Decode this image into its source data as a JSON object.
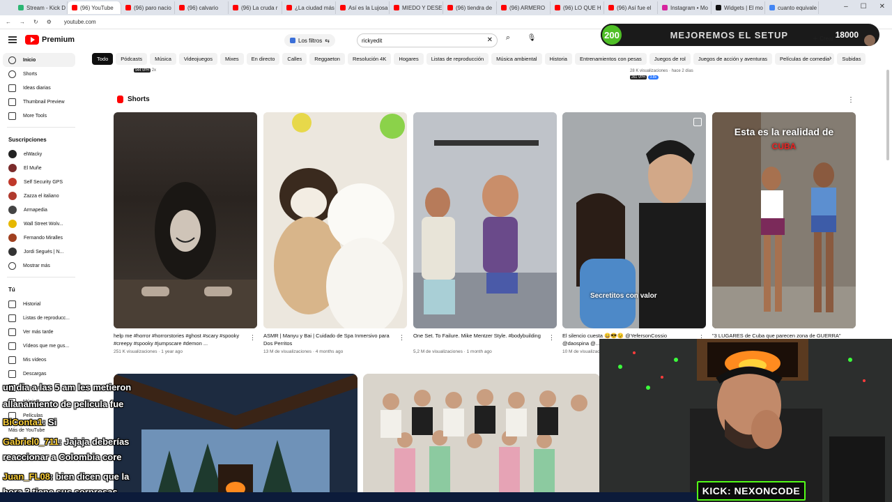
{
  "browser": {
    "tabs": [
      {
        "title": "Stream - Kick D",
        "color": "#2bb673"
      },
      {
        "title": "(96) YouTube",
        "color": "#ff0000",
        "active": true
      },
      {
        "title": "(96) paro nacio",
        "color": "#ff0000"
      },
      {
        "title": "(96) calvario",
        "color": "#ff0000"
      },
      {
        "title": "(96) La cruda r",
        "color": "#ff0000"
      },
      {
        "title": "¿La ciudad más",
        "color": "#ff0000"
      },
      {
        "title": "Así es la Lujosa",
        "color": "#ff0000"
      },
      {
        "title": "MIEDO Y DESE",
        "color": "#ff0000"
      },
      {
        "title": "(96) tiendra de",
        "color": "#ff0000"
      },
      {
        "title": "(96) ARMERO",
        "color": "#ff0000"
      },
      {
        "title": "(96) LO QUE H",
        "color": "#ff0000"
      },
      {
        "title": "(96) Así fue el",
        "color": "#ff0000"
      },
      {
        "title": "Instagram • Mo",
        "color": "#d6249f"
      },
      {
        "title": "Widgets | El mo",
        "color": "#111111"
      },
      {
        "title": "cuanto equivale",
        "color": "#4285f4"
      }
    ],
    "url": "youtube.com"
  },
  "masthead": {
    "brand": "Premium",
    "filters_label": "Los filtros",
    "search_value": "rickyedit",
    "create_label": "Crear"
  },
  "overlay": {
    "left_value": "200",
    "title": "MEJOREMOS EL SETUP",
    "right_value": "18000"
  },
  "chips": [
    "Todo",
    "Pódcasts",
    "Música",
    "Videojuegos",
    "Mixes",
    "En directo",
    "Calles",
    "Reggaeton",
    "Resolución 4K",
    "Hogares",
    "Listas de reproducción",
    "Música ambiental",
    "Historia",
    "Entrenamientos con pesas",
    "Juegos de rol",
    "Juegos de acción y aventuras",
    "Películas de comedia",
    "Subidas"
  ],
  "sidebar": {
    "main": [
      "Inicio",
      "Shorts",
      "Ideas diarias",
      "Thumbnail Preview",
      "More Tools"
    ],
    "subscriptions_title": "Suscripciones",
    "subscriptions": [
      {
        "name": "elWacky",
        "color": "#222222"
      },
      {
        "name": "El Muñe",
        "color": "#7a2b2b"
      },
      {
        "name": "Self Security GPS",
        "color": "#c0392b"
      },
      {
        "name": "Zazza el italiano",
        "color": "#b03a2e"
      },
      {
        "name": "Armapedia",
        "color": "#444444"
      },
      {
        "name": "Wall Street Wolv...",
        "color": "#e6b800"
      },
      {
        "name": "Fernando Miralles",
        "color": "#a04020"
      },
      {
        "name": "Jordi Segués | N...",
        "color": "#333333"
      }
    ],
    "show_more": "Mostrar más",
    "you_title": "Tú",
    "you_items": [
      "Historial",
      "Listas de reproducc...",
      "Ver más tarde",
      "Vídeos que me gus...",
      "Mis vídeos",
      "Descargas",
      "Mostrar más"
    ],
    "lower_items": [
      "Música",
      "Películas"
    ],
    "bottom_label": "Más de YouTube"
  },
  "prev_row": {
    "left_vph": "944 VPH",
    "left_ratio": "2x",
    "right_meta": "28 K visualizaciones · hace 2 días",
    "right_vph": "261 VPH",
    "right_ratio": "3.8x"
  },
  "shorts": {
    "section_title": "Shorts",
    "items": [
      {
        "title": "help me #horror #horrorstories #ghost #scary #spooky #creepy #spooky #jumpscare #demon ...",
        "views": "251 K visualizaciones",
        "age": "1 year ago"
      },
      {
        "title": "ASMR | Manyu y Bai | Cuidado de Spa Inmersivo para Dos Perritos",
        "views": "13 M de visualizaciones",
        "age": "4 months ago"
      },
      {
        "title": "One Set. To Failure. Mike Mentzer Style. #bodybuilding",
        "views": "5,2 M de visualizaciones",
        "age": "1 month ago"
      },
      {
        "title": "El silencio cuesta 😄😎😉 @YefersonCossio @daospina @...",
        "views": "10 M de visualizaciones",
        "overlay": "Secretitos con valor"
      },
      {
        "title": "\"3 LUGARES de Cuba que parecen zona de GUERRA\"",
        "overlay_line1": "Esta es la realidad de",
        "overlay_line2": "CUBA"
      }
    ]
  },
  "chat": [
    {
      "name": "",
      "text": "un dia a las 5 am les metieron"
    },
    {
      "name": "",
      "text": "allanamiento de pelicula fue"
    },
    {
      "name": "BiConta1",
      "text": ": Si"
    },
    {
      "name": "Gabriel0_711",
      "text": ": Jajaja deberías"
    },
    {
      "name": "",
      "text": "reaccionar a Colombia core"
    },
    {
      "name": "Juan_FL08",
      "text": ": bien dicen que la"
    },
    {
      "name": "",
      "text": "hora 3 tiene sus sorpresas"
    }
  ],
  "kick_label": "KICK: NEXONCODE"
}
